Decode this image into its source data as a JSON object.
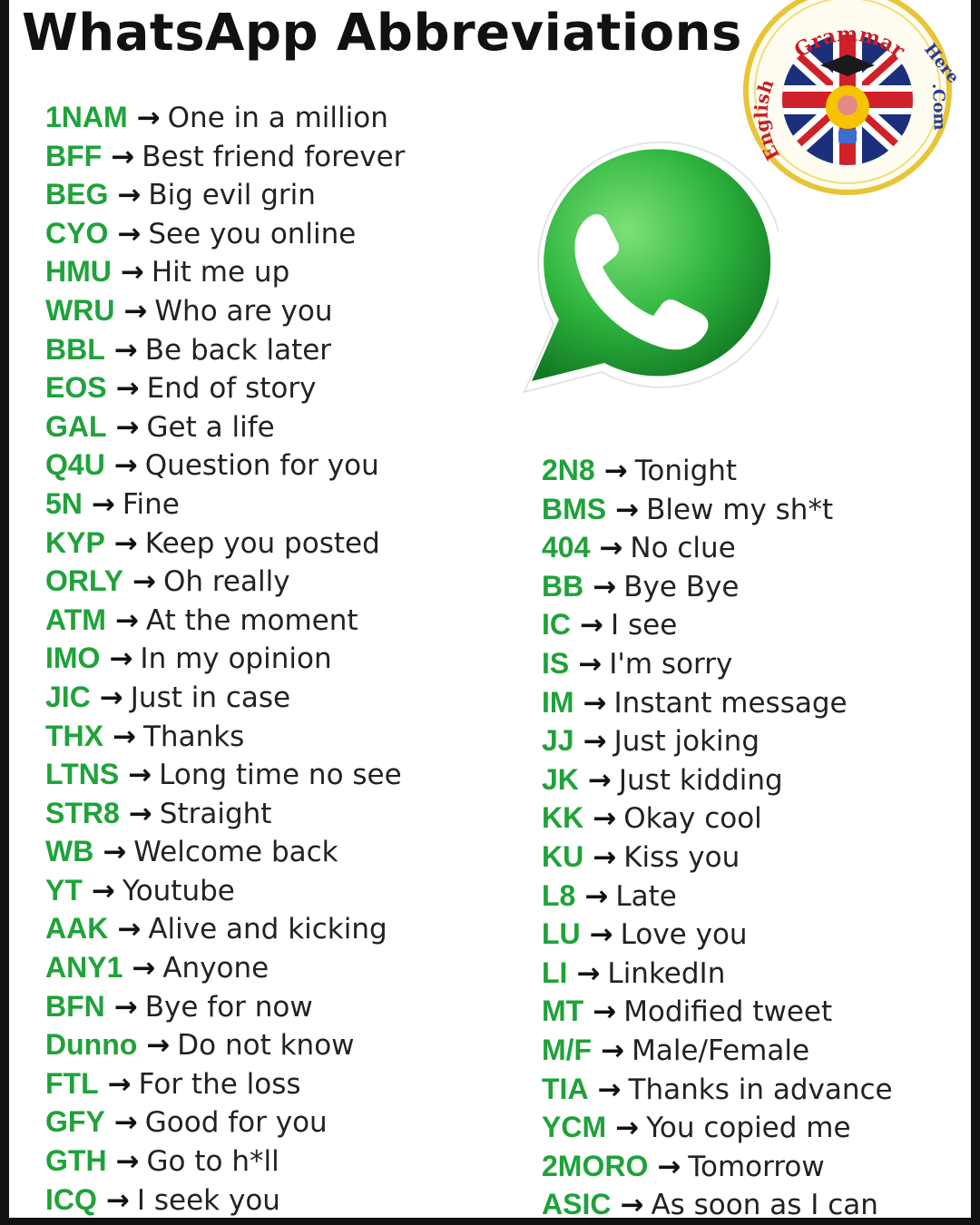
{
  "title": "WhatsApp Abbreviations",
  "badge": {
    "top_text": "Grammar",
    "right_text": "Here",
    "left_text": "English",
    "suffix": ".Com"
  },
  "icons": {
    "logo": "whatsapp-logo-icon",
    "arrow": "right-arrow-icon"
  },
  "colors": {
    "abbr": "#1fa23a",
    "logo_green": "#27b03f",
    "badge_ring": "#e8c437"
  },
  "arrow_glyph": "→",
  "left": [
    {
      "abbr": "1NAM",
      "meaning": "One in a million"
    },
    {
      "abbr": "BFF",
      "meaning": "Best friend forever"
    },
    {
      "abbr": "BEG",
      "meaning": "Big evil grin"
    },
    {
      "abbr": "CYO",
      "meaning": "See you online"
    },
    {
      "abbr": "HMU",
      "meaning": "Hit me up"
    },
    {
      "abbr": "WRU",
      "meaning": "Who are you"
    },
    {
      "abbr": "BBL",
      "meaning": "Be back later"
    },
    {
      "abbr": "EOS",
      "meaning": "End of story"
    },
    {
      "abbr": "GAL",
      "meaning": "Get a life"
    },
    {
      "abbr": "Q4U",
      "meaning": "Question for you"
    },
    {
      "abbr": "5N",
      "meaning": "Fine"
    },
    {
      "abbr": "KYP",
      "meaning": "Keep you posted"
    },
    {
      "abbr": "ORLY",
      "meaning": "Oh really"
    },
    {
      "abbr": "ATM",
      "meaning": "At the moment"
    },
    {
      "abbr": "IMO",
      "meaning": "In my opinion"
    },
    {
      "abbr": "JIC",
      "meaning": "Just in case"
    },
    {
      "abbr": "THX",
      "meaning": "Thanks"
    },
    {
      "abbr": "LTNS",
      "meaning": "Long time no see"
    },
    {
      "abbr": "STR8",
      "meaning": "Straight"
    },
    {
      "abbr": "WB",
      "meaning": "Welcome back"
    },
    {
      "abbr": "YT",
      "meaning": "Youtube"
    },
    {
      "abbr": "AAK",
      "meaning": "Alive and kicking"
    },
    {
      "abbr": "ANY1",
      "meaning": "Anyone"
    },
    {
      "abbr": "BFN",
      "meaning": "Bye for now"
    },
    {
      "abbr": "Dunno",
      "meaning": "Do not know"
    },
    {
      "abbr": "FTL",
      "meaning": "For the loss"
    },
    {
      "abbr": "GFY",
      "meaning": "Good for you"
    },
    {
      "abbr": "GTH",
      "meaning": "Go to h*ll"
    },
    {
      "abbr": "ICQ",
      "meaning": "I seek you"
    }
  ],
  "right": [
    {
      "abbr": "2N8",
      "meaning": "Tonight"
    },
    {
      "abbr": "BMS",
      "meaning": "Blew my sh*t"
    },
    {
      "abbr": "404",
      "meaning": "No clue"
    },
    {
      "abbr": "BB",
      "meaning": "Bye Bye"
    },
    {
      "abbr": "IC",
      "meaning": "I see"
    },
    {
      "abbr": "IS",
      "meaning": "I'm sorry"
    },
    {
      "abbr": "IM",
      "meaning": "Instant message"
    },
    {
      "abbr": "JJ",
      "meaning": "Just joking"
    },
    {
      "abbr": "JK",
      "meaning": "Just kidding"
    },
    {
      "abbr": "KK",
      "meaning": "Okay cool"
    },
    {
      "abbr": "KU",
      "meaning": "Kiss you"
    },
    {
      "abbr": "L8",
      "meaning": "Late"
    },
    {
      "abbr": "LU",
      "meaning": "Love you"
    },
    {
      "abbr": "LI",
      "meaning": "LinkedIn"
    },
    {
      "abbr": "MT",
      "meaning": "Modified tweet"
    },
    {
      "abbr": "M/F",
      "meaning": "Male/Female"
    },
    {
      "abbr": "TIA",
      "meaning": "Thanks in advance"
    },
    {
      "abbr": "YCM",
      "meaning": "You copied me"
    },
    {
      "abbr": "2MORO",
      "meaning": "Tomorrow"
    },
    {
      "abbr": "ASIC",
      "meaning": "As soon as I can"
    }
  ]
}
